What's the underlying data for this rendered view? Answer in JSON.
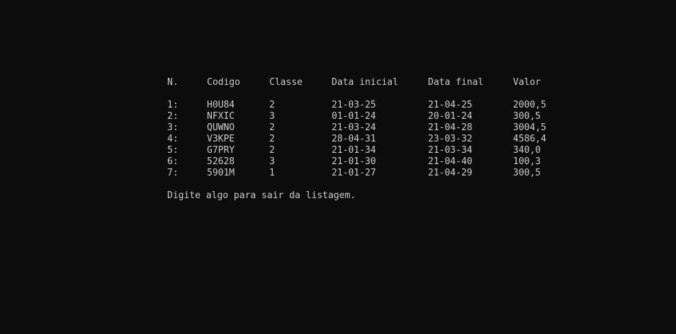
{
  "console": {
    "headers": [
      "N.",
      "Codigo",
      "Classe",
      "Data inicial",
      "Data final",
      "Valor"
    ],
    "rows": [
      {
        "n": "1:",
        "codigo": "H0U84",
        "classe": "2",
        "data_inicial": "21-03-25",
        "data_final": "21-04-25",
        "valor": "2000,5"
      },
      {
        "n": "2:",
        "codigo": "NFXIC",
        "classe": "3",
        "data_inicial": "01-01-24",
        "data_final": "20-01-24",
        "valor": "300,5"
      },
      {
        "n": "3:",
        "codigo": "QUWNO",
        "classe": "2",
        "data_inicial": "21-03-24",
        "data_final": "21-04-28",
        "valor": "3004,5"
      },
      {
        "n": "4:",
        "codigo": "V3KPE",
        "classe": "2",
        "data_inicial": "28-04-31",
        "data_final": "23-03-32",
        "valor": "4586,4"
      },
      {
        "n": "5:",
        "codigo": "G7PRY",
        "classe": "2",
        "data_inicial": "21-01-34",
        "data_final": "21-03-34",
        "valor": "340,0"
      },
      {
        "n": "6:",
        "codigo": "52628",
        "classe": "3",
        "data_inicial": "21-01-30",
        "data_final": "21-04-40",
        "valor": "100,3"
      },
      {
        "n": "7:",
        "codigo": "5901M",
        "classe": "1",
        "data_inicial": "21-01-27",
        "data_final": "21-04-29",
        "valor": "300,5"
      }
    ],
    "prompt": "Digite algo para sair da listagem.",
    "colors": {
      "background": "#0c0c0c",
      "text": "#cccccc"
    }
  }
}
